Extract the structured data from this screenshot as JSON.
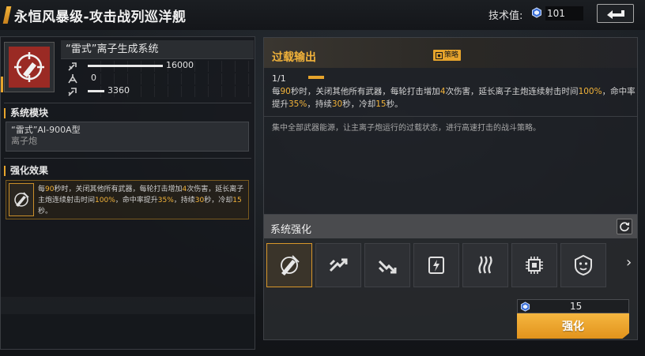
{
  "header": {
    "title": "永恒风暴级-攻击战列巡洋舰",
    "tech_label": "技术值:",
    "tech_value": "101",
    "back_icon": "back-arrow-icon"
  },
  "module": {
    "name": "“雷式”离子生成系统",
    "stats": [
      {
        "icon": "firepower-icon",
        "value": "16000",
        "fill": 0.45
      },
      {
        "icon": "armor-piercing-icon",
        "value": "0",
        "fill": 0.0
      },
      {
        "icon": "speed-icon",
        "value": "3360",
        "fill": 0.1
      }
    ]
  },
  "system_module": {
    "title": "系统模块",
    "name": "“雷式”AI-900A型",
    "type": "离子炮"
  },
  "enhance_effect": {
    "title": "强化效果",
    "text_parts": [
      "每",
      "90",
      "秒时，关闭其他所有武器，每轮打击增加",
      "4",
      "次伤害，延长离子主炮连续射击时间",
      "100%",
      "，命中率提升",
      "35%",
      "，持续",
      "30",
      "秒，冷却",
      "15",
      "秒。"
    ]
  },
  "overload": {
    "title": "过载输出",
    "tag": "策略",
    "level": "1/1",
    "description_parts": [
      "每",
      "90",
      "秒时，关闭其他所有武器，每轮打击增加",
      "4",
      "次伤害，延长离子主炮连续射击时间",
      "100%",
      "，命中率提升",
      "35%",
      "，持续",
      "30",
      "秒，冷却",
      "15",
      "秒。"
    ],
    "flavor": "集中全部武器能源，让主离子炮运行的过载状态，进行高速打击的战斗策略。"
  },
  "system_enhance": {
    "title": "系统强化",
    "slots": [
      {
        "icon": "overload-cannon-icon",
        "active": true
      },
      {
        "icon": "boost-up-icon",
        "active": false
      },
      {
        "icon": "boost-down-icon",
        "active": false
      },
      {
        "icon": "energy-card-icon",
        "active": false
      },
      {
        "icon": "heat-waves-icon",
        "active": false
      },
      {
        "icon": "chip-icon",
        "active": false
      },
      {
        "icon": "lion-emblem-icon",
        "active": false
      }
    ],
    "next_arrow": "›",
    "cost": "15",
    "button_label": "强化"
  },
  "colors": {
    "accent": "#e6a42c",
    "module_red": "#9a2a24"
  }
}
